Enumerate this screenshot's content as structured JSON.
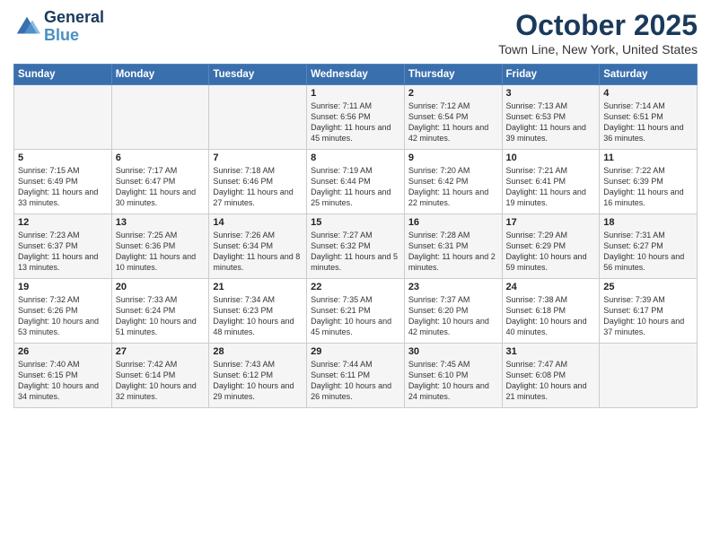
{
  "logo": {
    "line1": "General",
    "line2": "Blue"
  },
  "title": "October 2025",
  "subtitle": "Town Line, New York, United States",
  "days_of_week": [
    "Sunday",
    "Monday",
    "Tuesday",
    "Wednesday",
    "Thursday",
    "Friday",
    "Saturday"
  ],
  "weeks": [
    [
      {
        "day": "",
        "content": ""
      },
      {
        "day": "",
        "content": ""
      },
      {
        "day": "",
        "content": ""
      },
      {
        "day": "1",
        "content": "Sunrise: 7:11 AM\nSunset: 6:56 PM\nDaylight: 11 hours and 45 minutes."
      },
      {
        "day": "2",
        "content": "Sunrise: 7:12 AM\nSunset: 6:54 PM\nDaylight: 11 hours and 42 minutes."
      },
      {
        "day": "3",
        "content": "Sunrise: 7:13 AM\nSunset: 6:53 PM\nDaylight: 11 hours and 39 minutes."
      },
      {
        "day": "4",
        "content": "Sunrise: 7:14 AM\nSunset: 6:51 PM\nDaylight: 11 hours and 36 minutes."
      }
    ],
    [
      {
        "day": "5",
        "content": "Sunrise: 7:15 AM\nSunset: 6:49 PM\nDaylight: 11 hours and 33 minutes."
      },
      {
        "day": "6",
        "content": "Sunrise: 7:17 AM\nSunset: 6:47 PM\nDaylight: 11 hours and 30 minutes."
      },
      {
        "day": "7",
        "content": "Sunrise: 7:18 AM\nSunset: 6:46 PM\nDaylight: 11 hours and 27 minutes."
      },
      {
        "day": "8",
        "content": "Sunrise: 7:19 AM\nSunset: 6:44 PM\nDaylight: 11 hours and 25 minutes."
      },
      {
        "day": "9",
        "content": "Sunrise: 7:20 AM\nSunset: 6:42 PM\nDaylight: 11 hours and 22 minutes."
      },
      {
        "day": "10",
        "content": "Sunrise: 7:21 AM\nSunset: 6:41 PM\nDaylight: 11 hours and 19 minutes."
      },
      {
        "day": "11",
        "content": "Sunrise: 7:22 AM\nSunset: 6:39 PM\nDaylight: 11 hours and 16 minutes."
      }
    ],
    [
      {
        "day": "12",
        "content": "Sunrise: 7:23 AM\nSunset: 6:37 PM\nDaylight: 11 hours and 13 minutes."
      },
      {
        "day": "13",
        "content": "Sunrise: 7:25 AM\nSunset: 6:36 PM\nDaylight: 11 hours and 10 minutes."
      },
      {
        "day": "14",
        "content": "Sunrise: 7:26 AM\nSunset: 6:34 PM\nDaylight: 11 hours and 8 minutes."
      },
      {
        "day": "15",
        "content": "Sunrise: 7:27 AM\nSunset: 6:32 PM\nDaylight: 11 hours and 5 minutes."
      },
      {
        "day": "16",
        "content": "Sunrise: 7:28 AM\nSunset: 6:31 PM\nDaylight: 11 hours and 2 minutes."
      },
      {
        "day": "17",
        "content": "Sunrise: 7:29 AM\nSunset: 6:29 PM\nDaylight: 10 hours and 59 minutes."
      },
      {
        "day": "18",
        "content": "Sunrise: 7:31 AM\nSunset: 6:27 PM\nDaylight: 10 hours and 56 minutes."
      }
    ],
    [
      {
        "day": "19",
        "content": "Sunrise: 7:32 AM\nSunset: 6:26 PM\nDaylight: 10 hours and 53 minutes."
      },
      {
        "day": "20",
        "content": "Sunrise: 7:33 AM\nSunset: 6:24 PM\nDaylight: 10 hours and 51 minutes."
      },
      {
        "day": "21",
        "content": "Sunrise: 7:34 AM\nSunset: 6:23 PM\nDaylight: 10 hours and 48 minutes."
      },
      {
        "day": "22",
        "content": "Sunrise: 7:35 AM\nSunset: 6:21 PM\nDaylight: 10 hours and 45 minutes."
      },
      {
        "day": "23",
        "content": "Sunrise: 7:37 AM\nSunset: 6:20 PM\nDaylight: 10 hours and 42 minutes."
      },
      {
        "day": "24",
        "content": "Sunrise: 7:38 AM\nSunset: 6:18 PM\nDaylight: 10 hours and 40 minutes."
      },
      {
        "day": "25",
        "content": "Sunrise: 7:39 AM\nSunset: 6:17 PM\nDaylight: 10 hours and 37 minutes."
      }
    ],
    [
      {
        "day": "26",
        "content": "Sunrise: 7:40 AM\nSunset: 6:15 PM\nDaylight: 10 hours and 34 minutes."
      },
      {
        "day": "27",
        "content": "Sunrise: 7:42 AM\nSunset: 6:14 PM\nDaylight: 10 hours and 32 minutes."
      },
      {
        "day": "28",
        "content": "Sunrise: 7:43 AM\nSunset: 6:12 PM\nDaylight: 10 hours and 29 minutes."
      },
      {
        "day": "29",
        "content": "Sunrise: 7:44 AM\nSunset: 6:11 PM\nDaylight: 10 hours and 26 minutes."
      },
      {
        "day": "30",
        "content": "Sunrise: 7:45 AM\nSunset: 6:10 PM\nDaylight: 10 hours and 24 minutes."
      },
      {
        "day": "31",
        "content": "Sunrise: 7:47 AM\nSunset: 6:08 PM\nDaylight: 10 hours and 21 minutes."
      },
      {
        "day": "",
        "content": ""
      }
    ]
  ]
}
